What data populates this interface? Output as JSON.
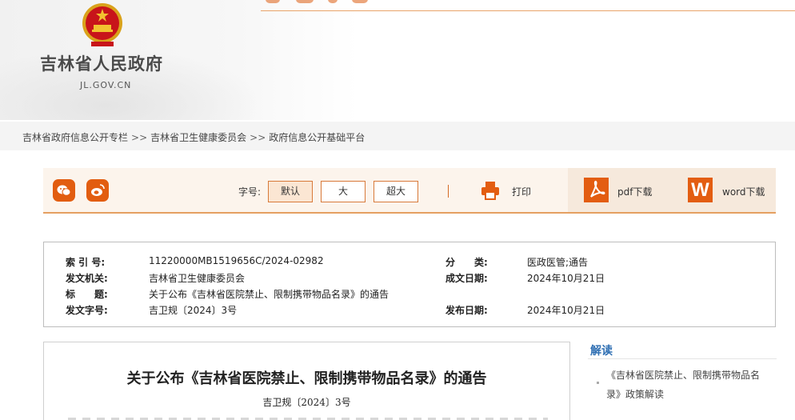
{
  "site": {
    "title": "吉林省人民政府",
    "domain": "JL.GOV.CN"
  },
  "breadcrumb": {
    "item1": "吉林省政府信息公开专栏",
    "item2": "吉林省卫生健康委员会",
    "item3": "政府信息公开基础平台",
    "separator": ">>"
  },
  "toolbar": {
    "font_size_label": "字号:",
    "font_default": "默认",
    "font_large": "大",
    "font_xlarge": "超大",
    "print_label": "打印",
    "pdf_label": "pdf下载",
    "word_label": "word下载",
    "word_glyph": "W",
    "icons": [
      "wechat-icon",
      "weibo-icon",
      "printer-icon",
      "pdf-icon",
      "word-icon"
    ],
    "accent_color": "#e35d11"
  },
  "meta": {
    "index_key": "索 引 号:",
    "index_value": "11220000MB1519656C/2024-02982",
    "category_key": "分　　类:",
    "category_value": "医政医管;通告",
    "issuer_key": "发文机关:",
    "issuer_value": "吉林省卫生健康委员会",
    "date_written_key": "成文日期:",
    "date_written_value": "2024年10月21日",
    "title_key": "标　　题:",
    "title_value": "关于公布《吉林省医院禁止、限制携带物品名录》的通告",
    "doc_no_key": "发文字号:",
    "doc_no_value": "吉卫规〔2024〕3号",
    "publish_date_key": "发布日期:",
    "publish_date_value": "2024年10月21日"
  },
  "article": {
    "title": "关于公布《吉林省医院禁止、限制携带物品名录》的通告",
    "doc_no": "吉卫规〔2024〕3号"
  },
  "sidebar": {
    "title": "解读",
    "link": "《吉林省医院禁止、限制携带物品名录》政策解读",
    "title_color": "#2f6fb3"
  }
}
